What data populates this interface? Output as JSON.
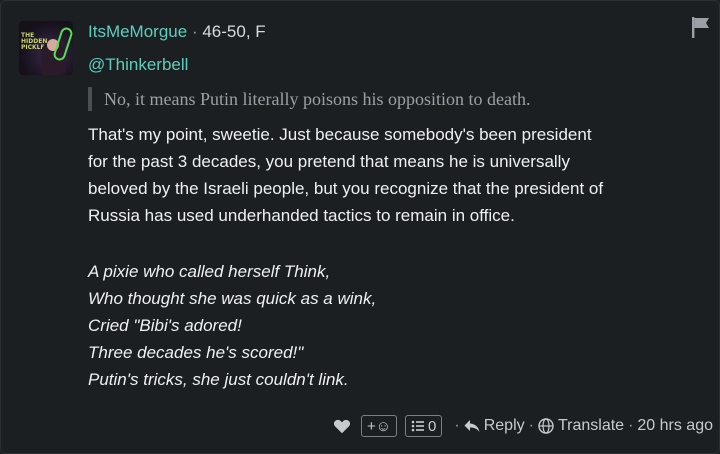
{
  "author": {
    "username": "ItsMeMorgue",
    "separator": "·",
    "meta": "46-50, F",
    "avatar_text": "THE HIDDEN PICKLE"
  },
  "reply_to": "@Thinkerbell",
  "quote": "No, it means Putin literally poisons his opposition to death.",
  "body_lines": [
    "That's my point, sweetie. Just because somebody's been president",
    "for the past 3 decades, you pretend that means he is universally",
    "beloved by the Israeli people, but you recognize that the president of",
    "Russia has used underhanded tactics to remain in office."
  ],
  "poem_lines": [
    "A pixie who called herself Think,",
    "Who thought she was quick as a wink,",
    "Cried \"Bibi's adored!",
    "Three decades he's scored!\"",
    "Putin's tricks, she just couldn't link."
  ],
  "footer": {
    "react_label": "+☺",
    "list_count": "0",
    "dot": "·",
    "reply_label": "Reply",
    "translate_label": "Translate",
    "time": "20 hrs ago"
  },
  "icons": {
    "heart": "heart-icon",
    "flag": "flag-icon",
    "reply": "reply-arrow-icon",
    "globe": "globe-icon",
    "list": "list-icon"
  },
  "colors": {
    "background": "#1c1f22",
    "username": "#5ecdbe",
    "quote_text": "#9aa0a5",
    "body_text": "#eef0f2"
  }
}
